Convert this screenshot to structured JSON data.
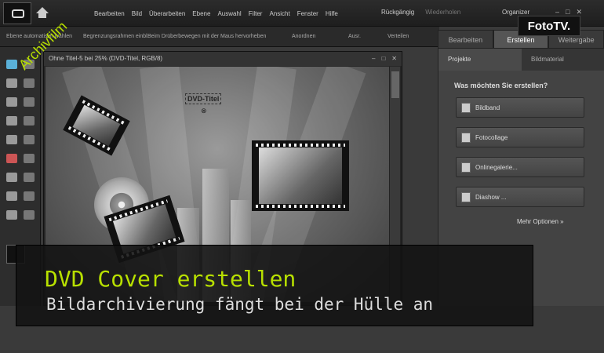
{
  "menubar": {
    "items": [
      "Bearbeiten",
      "Bild",
      "Überarbeiten",
      "Ebene",
      "Auswahl",
      "Filter",
      "Ansicht",
      "Fenster",
      "Hilfe"
    ],
    "undo": "Rückgängig",
    "redo": "Wiederholen",
    "organizer": "Organizer",
    "win_min": "–",
    "win_max": "□",
    "win_close": "✕"
  },
  "optionsbar": {
    "o1": "Ebene automatisch wählen",
    "o2": "Begrenzungsrahmen einbl.",
    "o3": "Beim Drüberbewegen mit der Maus hervorheben",
    "arrange": "Anordnen",
    "align": "Ausr.",
    "distribute": "Verteilen"
  },
  "modetabs": [
    "Bearbeiten",
    "Erstellen",
    "Weitergabe"
  ],
  "document": {
    "title": "Ohne Titel-5 bei 25% (DVD-Titel, RGB/8)",
    "btn_min": "–",
    "btn_max": "□",
    "btn_close": "✕",
    "dvd_title": "DVD-Titel",
    "handle": "⊗"
  },
  "panel": {
    "tab_projects": "Projekte",
    "tab_material": "Bildmaterial",
    "question": "Was möchten Sie erstellen?",
    "buttons": [
      "Bildband",
      "Fotocollage",
      "Onlinegalerie...",
      "Diashow ..."
    ],
    "more": "Mehr Optionen"
  },
  "overlay": {
    "badge": "FotoTV.",
    "archive": "Archivfilm",
    "headline": "DVD Cover erstellen",
    "subline": "Bildarchivierung fängt bei der Hülle an"
  },
  "colors": {
    "accent": "#b8e000",
    "background": "#3a3a3a"
  }
}
